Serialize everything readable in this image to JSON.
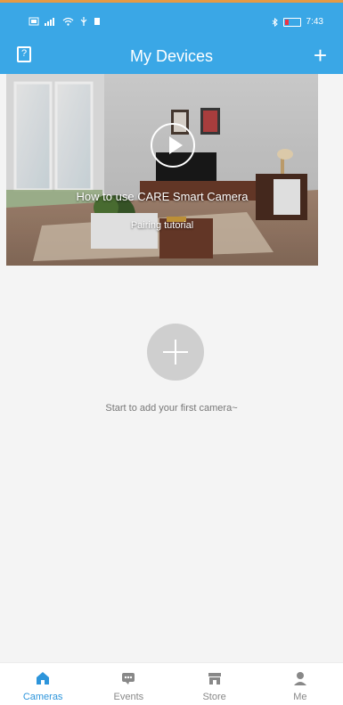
{
  "status_bar": {
    "time": "7:43"
  },
  "header": {
    "title": "My Devices"
  },
  "hero": {
    "title": "How to use CARE Smart Camera",
    "subtitle": "Pairing tutorial"
  },
  "empty_state": {
    "text": "Start to add your first camera~"
  },
  "tabs": [
    {
      "label": "Cameras"
    },
    {
      "label": "Events"
    },
    {
      "label": "Store"
    },
    {
      "label": "Me"
    }
  ],
  "colors": {
    "header": "#3aa7e6",
    "active_tab": "#2d95db",
    "inactive_tab": "#888888",
    "topline": "#e59a45"
  }
}
